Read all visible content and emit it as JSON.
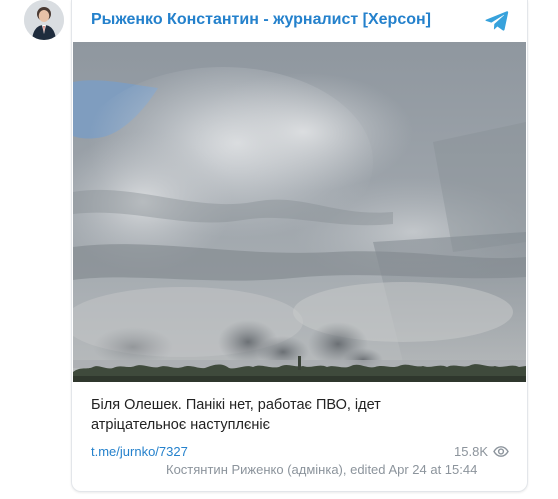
{
  "channel": {
    "title": "Рыженко Константин - журналист [Херсон]",
    "avatar_icon": "channel-avatar-photo",
    "platform_icon": "telegram-icon",
    "accent_color": "#2481cc"
  },
  "post": {
    "photo_description_icon": "cloudy-sky-photo",
    "text_line1": "Біля Олешек. Панікі нет, работає ПВО, ідет",
    "text_line2": "атріцательноє наступлєніє",
    "link": "t.me/jurnko/7327",
    "views": "15.8K",
    "author": "Костянтин Риженко (адмінка), edited",
    "date": "Apr 24 at 15:44"
  }
}
